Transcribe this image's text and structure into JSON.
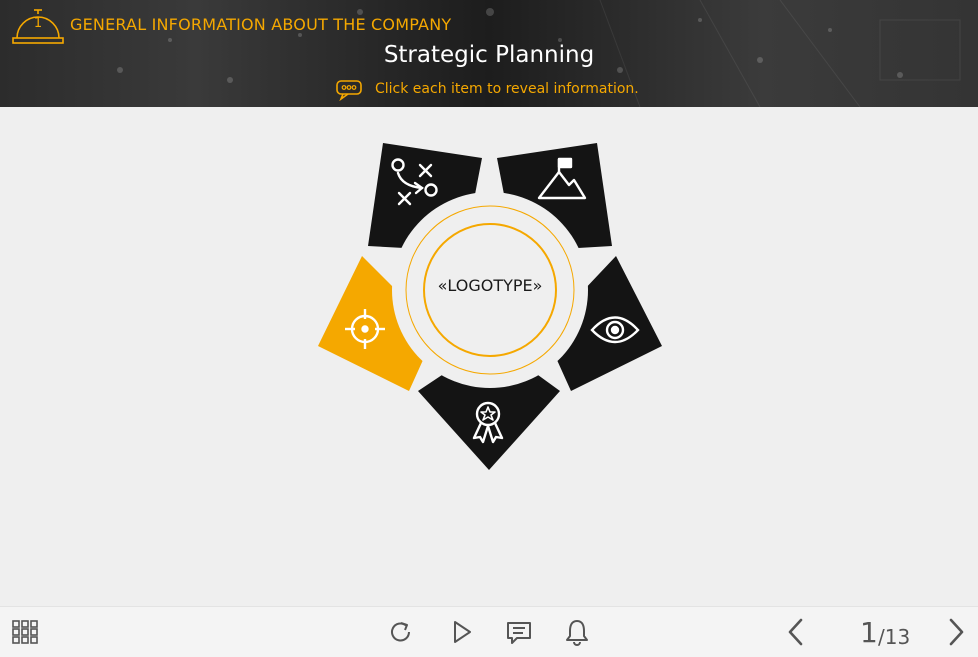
{
  "header": {
    "lesson_number": "1",
    "section_title": "GENERAL INFORMATION ABOUT THE COMPANY",
    "page_title": "Strategic Planning",
    "hint": "Click each item to reveal information."
  },
  "diagram": {
    "center_label": "«LOGOTYPE»",
    "segments": [
      {
        "icon": "strategy-play-icon",
        "state": "default"
      },
      {
        "icon": "mountain-flag-icon",
        "state": "default"
      },
      {
        "icon": "eye-icon",
        "state": "default"
      },
      {
        "icon": "award-ribbon-icon",
        "state": "default"
      },
      {
        "icon": "target-crosshair-icon",
        "state": "active"
      }
    ]
  },
  "colors": {
    "accent": "#f5a800",
    "segment_dark": "#141414",
    "background": "#efefef",
    "header_text": "#ffffff"
  },
  "toolbar": {
    "menu_icon": "grid-menu-icon",
    "replay_icon": "replay-icon",
    "play_icon": "play-icon",
    "comments_icon": "comments-icon",
    "notifications_icon": "bell-icon",
    "prev_icon": "chevron-left-icon",
    "next_icon": "chevron-right-icon",
    "current_page": "1",
    "total_pages": "/13"
  }
}
